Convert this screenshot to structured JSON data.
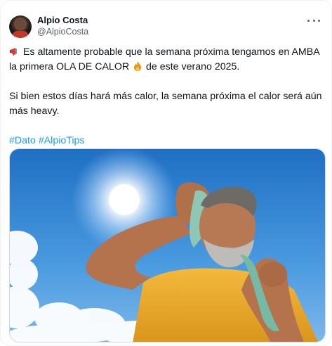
{
  "author": {
    "name": "Alpio Costa",
    "handle": "@AlpioCosta"
  },
  "tweet": {
    "line1_a": "Es altamente probable que la semana próxima tengamos en AMBA la primera OLA DE CALOR",
    "line1_b": "de este verano 2025.",
    "line2": "Si bien estos días hará más calor, la semana próxima el calor será aún más heavy.",
    "hashtags": [
      "#Dato",
      "#AlpioTips"
    ]
  },
  "icons": {
    "megaphone": "megaphone-icon",
    "fire": "fire-icon",
    "more": "more-options-icon"
  },
  "colors": {
    "link": "#1d9bf0",
    "secondary_text": "#536471"
  }
}
